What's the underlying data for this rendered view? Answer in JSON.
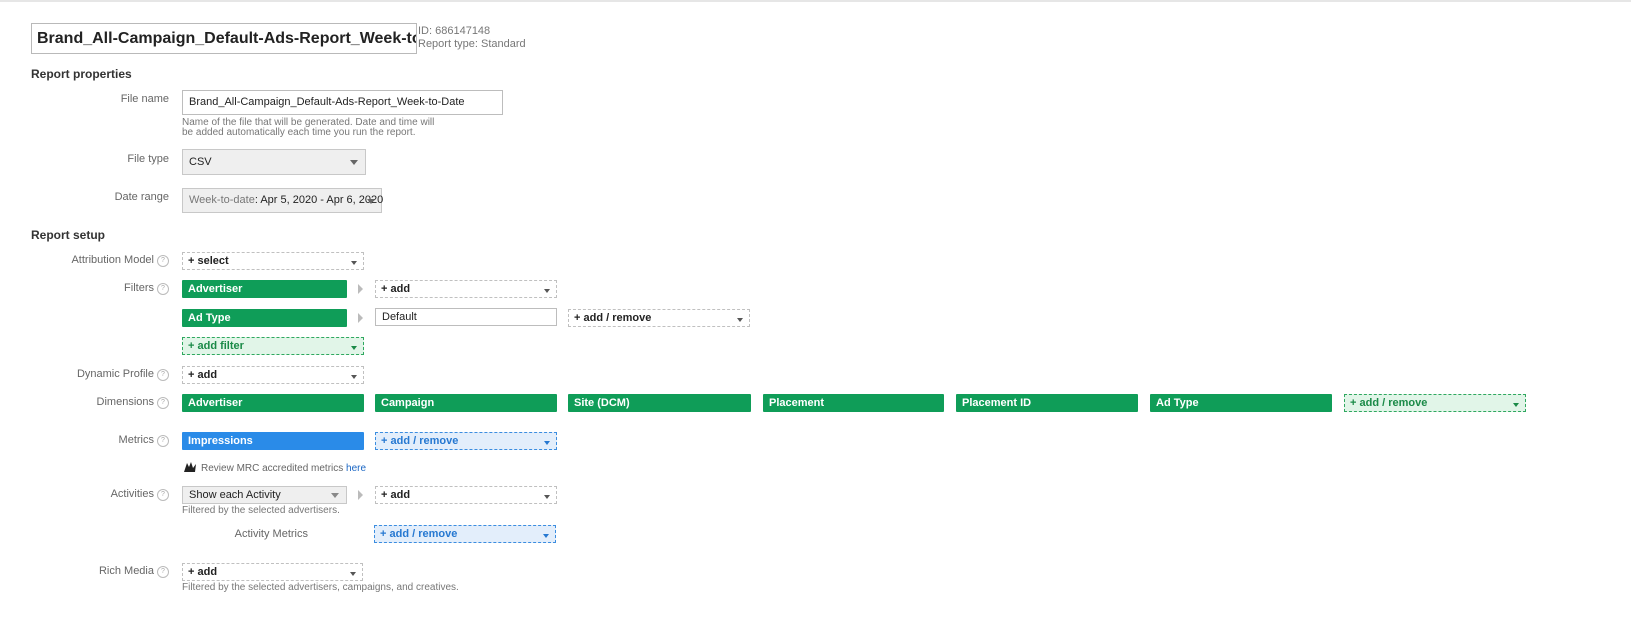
{
  "header": {
    "report_title": "Brand_All-Campaign_Default-Ads-Report_Week-to-Da",
    "id_text": "ID: 686147148",
    "report_type": "Report type: Standard"
  },
  "report_properties": {
    "title": "Report properties",
    "file_name_label": "File name",
    "file_name_value": "Brand_All-Campaign_Default-Ads-Report_Week-to-Date",
    "file_name_hint_1": "Name of the file that will be generated. Date and time will",
    "file_name_hint_2": "be added automatically each time you run the report.",
    "file_type_label": "File type",
    "file_type_value": "CSV",
    "date_range_label": "Date range",
    "date_range_value": "Week-to-date",
    "date_range_dates": ": Apr 5, 2020 - Apr 6, 2020"
  },
  "report_setup": {
    "title": "Report setup",
    "attribution_label": "Attribution Model",
    "attribution_value": "+ select",
    "filters_label": "Filters",
    "filters": [
      {
        "chip": "Advertiser",
        "value": "+ add"
      },
      {
        "chip": "Ad Type",
        "value": "Default",
        "extra": "+ add / remove"
      }
    ],
    "add_filter": "+ add filter",
    "dynamic_profile_label": "Dynamic Profile",
    "dynamic_profile_value": "+ add",
    "dimensions_label": "Dimensions",
    "dimensions": [
      "Advertiser",
      "Campaign",
      "Site (DCM)",
      "Placement",
      "Placement ID",
      "Ad Type"
    ],
    "dimensions_add": "+ add / remove",
    "metrics_label": "Metrics",
    "metrics": [
      "Impressions"
    ],
    "metrics_add": "+ add / remove",
    "mrc_text": "Review MRC accredited metrics",
    "mrc_link": "here",
    "activities_label": "Activities",
    "activities_select": "Show each Activity",
    "activities_add": "+ add",
    "activities_hint": "Filtered by the selected advertisers.",
    "activity_metrics_label": "Activity Metrics",
    "activity_metrics_add": "+ add / remove",
    "rich_media_label": "Rich Media",
    "rich_media_add": "+ add",
    "rich_media_hint": "Filtered by the selected advertisers, campaigns, and creatives."
  }
}
